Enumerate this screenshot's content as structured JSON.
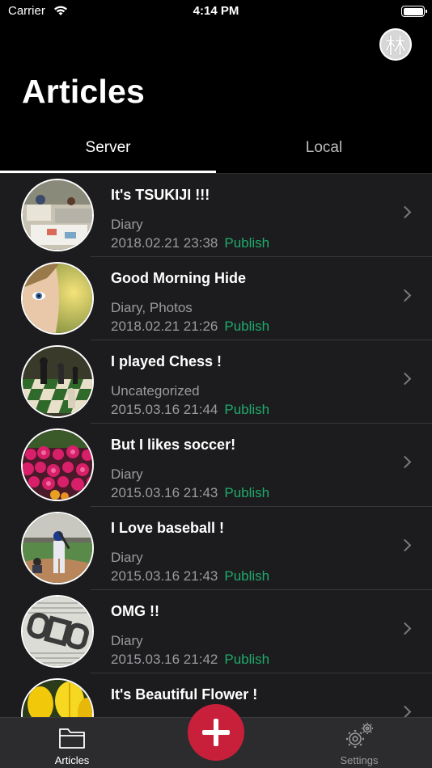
{
  "status_bar": {
    "carrier": "Carrier",
    "time": "4:14 PM"
  },
  "header": {
    "title": "Articles",
    "avatar_char": "林"
  },
  "segments": [
    {
      "label": "Server",
      "selected": true
    },
    {
      "label": "Local",
      "selected": false
    }
  ],
  "articles": [
    {
      "title": "It's TSUKIJI !!!",
      "category": "Diary",
      "date": "2018.02.21 23:38",
      "status": "Publish",
      "image": "market-photo"
    },
    {
      "title": "Good Morning Hide",
      "category": "Diary, Photos",
      "date": "2018.02.21 21:26",
      "status": "Publish",
      "image": "portrait-photo"
    },
    {
      "title": "I played Chess !",
      "category": "Uncategorized",
      "date": "2015.03.16 21:44",
      "status": "Publish",
      "image": "chess-photo"
    },
    {
      "title": "But I likes soccer!",
      "category": "Diary",
      "date": "2015.03.16 21:43",
      "status": "Publish",
      "image": "flowers-photo"
    },
    {
      "title": "I Love baseball !",
      "category": "Diary",
      "date": "2015.03.16 21:43",
      "status": "Publish",
      "image": "baseball-photo"
    },
    {
      "title": "OMG !!",
      "category": "Diary",
      "date": "2015.03.16 21:42",
      "status": "Publish",
      "image": "newspaper-photo"
    },
    {
      "title": "It's Beautiful Flower !",
      "category": "",
      "date": "",
      "status": "",
      "image": "tulip-photo"
    }
  ],
  "tabbar": {
    "articles_label": "Articles",
    "settings_label": "Settings"
  },
  "colors": {
    "accent_publish": "#1faa6c",
    "fab": "#c8203a"
  }
}
